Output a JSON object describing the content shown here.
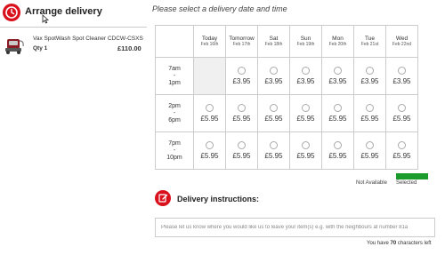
{
  "step": {
    "title": "Arrange delivery"
  },
  "product": {
    "name": "Vax SpotWash Spot Cleaner CDCW-CSXS",
    "qty": "Qty 1",
    "price": "£110.00"
  },
  "prompt": "Please select a delivery date and time",
  "calendar": {
    "days": [
      {
        "name": "Today",
        "date": "Feb 16th"
      },
      {
        "name": "Tomorrow",
        "date": "Feb 17th"
      },
      {
        "name": "Sat",
        "date": "Feb 18th"
      },
      {
        "name": "Sun",
        "date": "Feb 19th"
      },
      {
        "name": "Mon",
        "date": "Feb 20th"
      },
      {
        "name": "Tue",
        "date": "Feb 21st"
      },
      {
        "name": "Wed",
        "date": "Feb 22nd"
      }
    ],
    "slots": [
      {
        "start": "7am",
        "sep": "-",
        "end": "1pm",
        "prices": [
          null,
          "£3.95",
          "£3.95",
          "£3.95",
          "£3.95",
          "£3.95",
          "£3.95"
        ]
      },
      {
        "start": "2pm",
        "sep": "-",
        "end": "6pm",
        "prices": [
          "£5.95",
          "£5.95",
          "£5.95",
          "£5.95",
          "£5.95",
          "£5.95",
          "£5.95"
        ]
      },
      {
        "start": "7pm",
        "sep": "-",
        "end": "10pm",
        "prices": [
          "£5.95",
          "£5.95",
          "£5.95",
          "£5.95",
          "£5.95",
          "£5.95",
          "£5.95"
        ]
      }
    ]
  },
  "legend": {
    "not_available": "Not Available",
    "selected": "Selected",
    "selected_color": "#1a9b2b"
  },
  "instructions": {
    "title": "Delivery instructions:",
    "placeholder": "Please let us know where you would like us to leave your item(s) e.g. with the neighbours at number 81a",
    "chars_prefix": "You have",
    "chars_count": "70",
    "chars_suffix": "characters left"
  },
  "colors": {
    "accent": "#d9111c"
  }
}
